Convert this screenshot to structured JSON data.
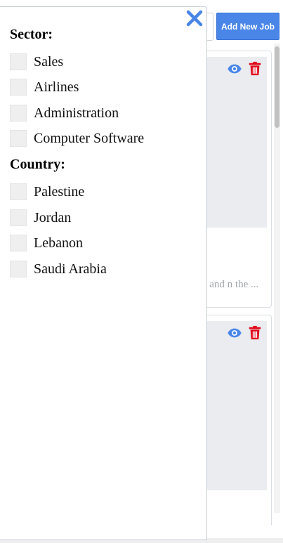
{
  "header": {
    "add_job_label": "Add New Job"
  },
  "jobs": [
    {
      "description": "printing and n the ..."
    },
    {
      "description": ""
    }
  ],
  "filters": {
    "sector": {
      "heading": "Sector:",
      "items": [
        {
          "label": "Sales",
          "checked": false
        },
        {
          "label": "Airlines",
          "checked": false
        },
        {
          "label": "Administration",
          "checked": false
        },
        {
          "label": "Computer Software",
          "checked": false
        }
      ]
    },
    "country": {
      "heading": "Country:",
      "items": [
        {
          "label": "Palestine",
          "checked": false
        },
        {
          "label": "Jordan",
          "checked": false
        },
        {
          "label": "Lebanon",
          "checked": false
        },
        {
          "label": "Saudi Arabia",
          "checked": false
        }
      ]
    }
  },
  "icons": {
    "close": "close-icon",
    "view": "eye-icon",
    "delete": "trash-icon"
  },
  "colors": {
    "primary": "#4a86e8",
    "danger": "#e0091b",
    "checkbox_bg": "#efefef"
  }
}
